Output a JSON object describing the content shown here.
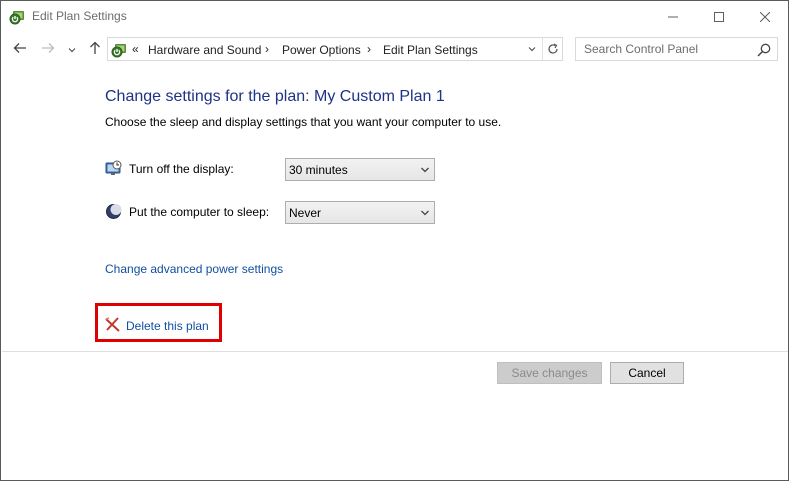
{
  "window": {
    "title": "Edit Plan Settings",
    "title_icon": "power-options-icon",
    "controls": {
      "minimize": "minimize-icon",
      "maximize": "maximize-icon",
      "close": "close-icon"
    }
  },
  "nav": {
    "back_icon": "arrow-left-icon",
    "forward_icon": "arrow-right-icon",
    "recent_icon": "chevron-down-icon",
    "up_icon": "arrow-up-icon",
    "address": {
      "overflow": "«",
      "crumbs": [
        "Hardware and Sound",
        "Power Options",
        "Edit Plan Settings"
      ],
      "separator": "›"
    },
    "refresh_icon": "refresh-icon",
    "search": {
      "placeholder": "Search Control Panel",
      "value": ""
    }
  },
  "main": {
    "heading": "Change settings for the plan: My Custom Plan 1",
    "subtitle": "Choose the sleep and display settings that you want your computer to use.",
    "settings": [
      {
        "label": "Turn off the display:",
        "value": "30 minutes",
        "icon": "monitor-icon"
      },
      {
        "label": "Put the computer to sleep:",
        "value": "Never",
        "icon": "sleep-icon"
      }
    ],
    "advanced_link": "Change advanced power settings",
    "delete_link": "Delete this plan"
  },
  "footer": {
    "save_label": "Save changes",
    "cancel_label": "Cancel"
  },
  "colors": {
    "heading": "#1e3287",
    "link": "#0f4f9e",
    "highlight_border": "#e10000"
  }
}
